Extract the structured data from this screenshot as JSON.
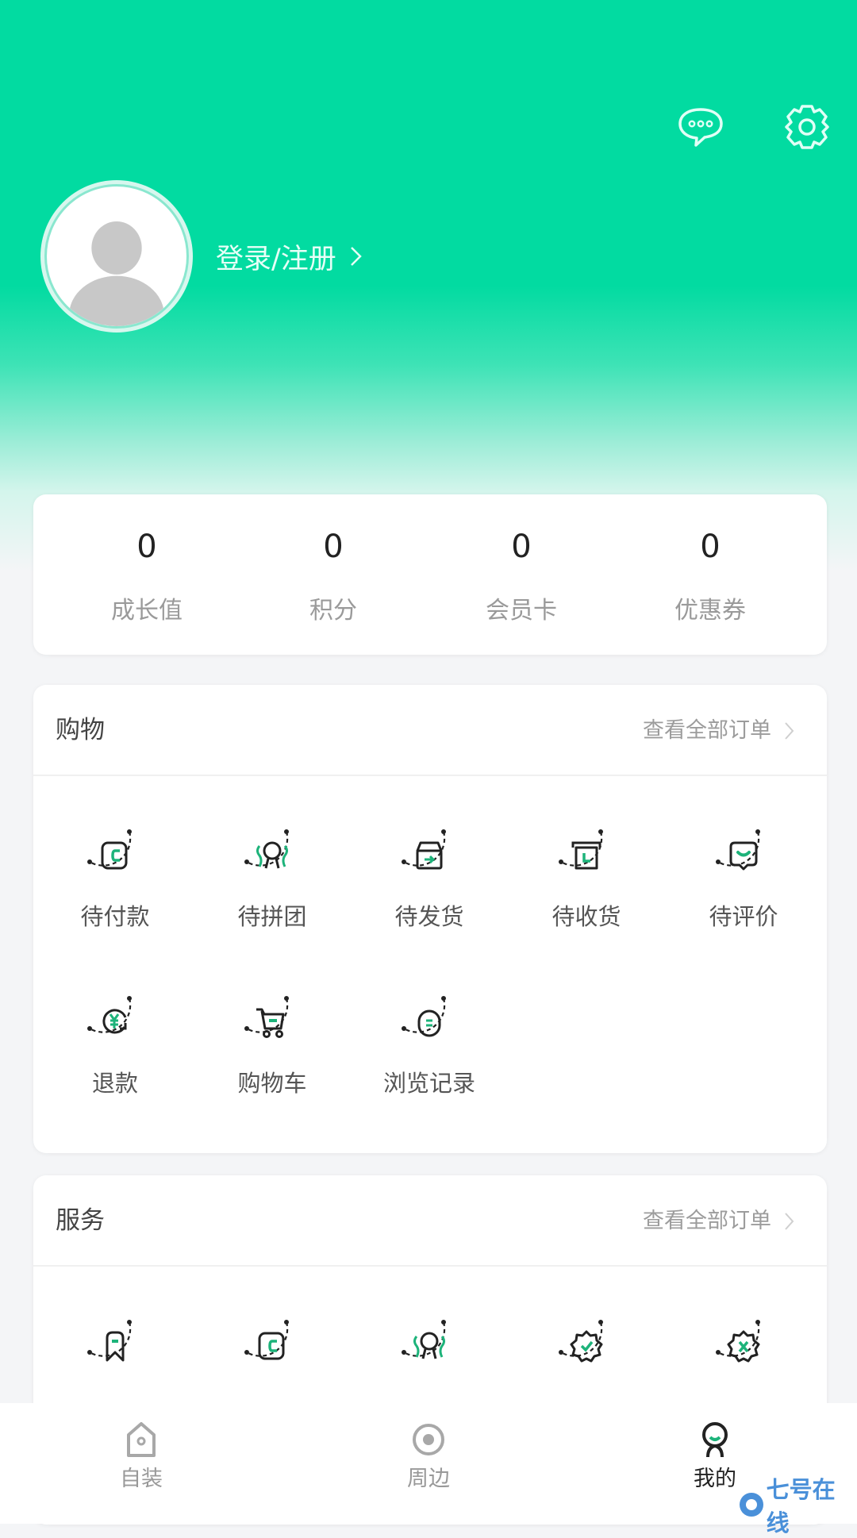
{
  "header": {
    "message_icon": "chat-bubble-ellipsis-icon",
    "settings_icon": "gear-icon",
    "login_label": "登录/注册",
    "avatar": "default-avatar-placeholder"
  },
  "colors": {
    "brand": "#02DBA1",
    "accent_green": "#1DB37A",
    "icon_stroke": "#222222",
    "watermark": "#4A90D9"
  },
  "stats": [
    {
      "value": "0",
      "label": "成长值"
    },
    {
      "value": "0",
      "label": "积分"
    },
    {
      "value": "0",
      "label": "会员卡"
    },
    {
      "value": "0",
      "label": "优惠券"
    }
  ],
  "shopping": {
    "title": "购物",
    "link": "查看全部订单",
    "items": [
      {
        "label": "待付款",
        "icon": "wallet-icon"
      },
      {
        "label": "待拼团",
        "icon": "group-buy-icon"
      },
      {
        "label": "待发货",
        "icon": "box-send-icon"
      },
      {
        "label": "待收货",
        "icon": "box-receive-icon"
      },
      {
        "label": "待评价",
        "icon": "comment-icon"
      },
      {
        "label": "退款",
        "icon": "refund-yuan-icon"
      },
      {
        "label": "购物车",
        "icon": "cart-icon"
      },
      {
        "label": "浏览记录",
        "icon": "history-icon"
      }
    ]
  },
  "service": {
    "title": "服务",
    "link": "查看全部订单",
    "items": [
      {
        "label": "",
        "icon": "bookmark-icon"
      },
      {
        "label": "",
        "icon": "wallet-icon"
      },
      {
        "label": "",
        "icon": "group-buy-icon"
      },
      {
        "label": "",
        "icon": "badge-check-icon"
      },
      {
        "label": "",
        "icon": "badge-cancel-icon"
      }
    ]
  },
  "tabbar": {
    "tabs": [
      {
        "label": "自装",
        "icon": "home-icon",
        "active": false
      },
      {
        "label": "周边",
        "icon": "nearby-target-icon",
        "active": false
      },
      {
        "label": "我的",
        "icon": "profile-icon",
        "active": true
      }
    ]
  },
  "watermark": "七号在线"
}
